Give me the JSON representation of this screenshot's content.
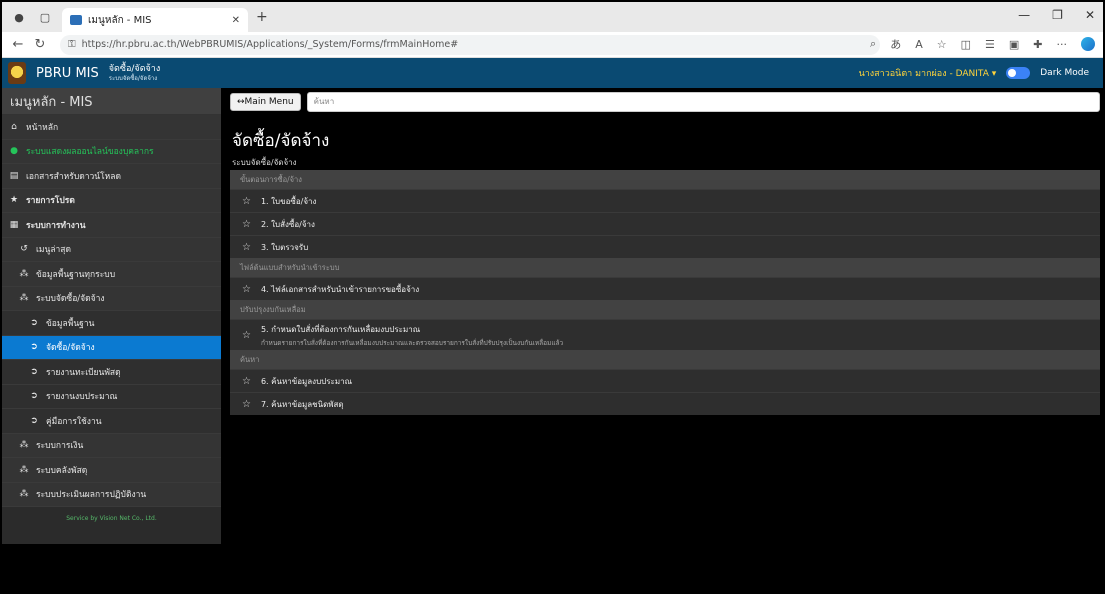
{
  "browser": {
    "tab_title": "เมนูหลัก - MIS",
    "url": "https://hr.pbru.ac.th/WebPBRUMIS/Applications/_System/Forms/frmMainHome#"
  },
  "header": {
    "brand": "PBRU MIS",
    "module_title": "จัดซื้อ/จัดจ้าง",
    "module_sub": "ระบบจัดซื้อ/จัดจ้าง",
    "user": "นางสาวอนิตา มากผ่อง - DANITA",
    "dark_mode_label": "Dark Mode"
  },
  "sidebar": {
    "title": "เมนูหลัก - MIS",
    "footer": "Service by Vision Net Co., Ltd.",
    "items": [
      {
        "label": "หน้าหลัก",
        "icon": "home-icon",
        "glyph": "⌂",
        "level": 0
      },
      {
        "label": "ระบบแสดงผลออนไลน์ของบุคลากร",
        "icon": "globe-icon",
        "glyph": "●",
        "level": 0,
        "style": "green"
      },
      {
        "label": "เอกสารสำหรับดาวน์โหลด",
        "icon": "document-icon",
        "glyph": "▤",
        "level": 0
      },
      {
        "label": "รายการโปรด",
        "icon": "star-icon",
        "glyph": "★",
        "level": 0,
        "style": "bold"
      },
      {
        "label": "ระบบการทำงาน",
        "icon": "grid-icon",
        "glyph": "▦",
        "level": 0,
        "style": "bold"
      },
      {
        "label": "เมนูล่าสุด",
        "icon": "history-icon",
        "glyph": "↺",
        "level": 1
      },
      {
        "label": "ข้อมูลพื้นฐานทุกระบบ",
        "icon": "cubes-icon",
        "glyph": "⁂",
        "level": 1
      },
      {
        "label": "ระบบจัดซื้อ/จัดจ้าง",
        "icon": "cubes-icon",
        "glyph": "⁂",
        "level": 1
      },
      {
        "label": "ข้อมูลพื้นฐาน",
        "icon": "circle-arrow-icon",
        "glyph": "➲",
        "level": 2
      },
      {
        "label": "จัดซื้อ/จัดจ้าง",
        "icon": "circle-arrow-icon",
        "glyph": "➲",
        "level": 2,
        "style": "active"
      },
      {
        "label": "รายงานทะเบียนพัสดุ",
        "icon": "circle-arrow-icon",
        "glyph": "➲",
        "level": 2
      },
      {
        "label": "รายงานงบประมาณ",
        "icon": "circle-arrow-icon",
        "glyph": "➲",
        "level": 2
      },
      {
        "label": "คู่มือการใช้งาน",
        "icon": "circle-arrow-icon",
        "glyph": "➲",
        "level": 2
      },
      {
        "label": "ระบบการเงิน",
        "icon": "cubes-icon",
        "glyph": "⁂",
        "level": 1
      },
      {
        "label": "ระบบคลังพัสดุ",
        "icon": "cubes-icon",
        "glyph": "⁂",
        "level": 1
      },
      {
        "label": "ระบบประเมินผลการปฏิบัติงาน",
        "icon": "cubes-icon",
        "glyph": "⁂",
        "level": 1
      }
    ]
  },
  "main": {
    "main_menu_button": "↔Main Menu",
    "search_placeholder": "ค้นหา",
    "page_title": "จัดซื้อ/จัดจ้าง",
    "page_subtitle": "ระบบจัดซื้อ/จัดจ้าง",
    "sections": [
      {
        "title": "ขั้นตอนการซื้อ/จ้าง",
        "rows": [
          {
            "label": "1. ใบขอซื้อ/จ้าง"
          },
          {
            "label": "2. ใบสั่งซื้อ/จ้าง"
          },
          {
            "label": "3. ใบตรวจรับ"
          }
        ]
      },
      {
        "title": "ไฟล์ต้นแบบสำหรับนำเข้าระบบ",
        "rows": [
          {
            "label": "4. ไฟล์เอกสารสำหรับนำเข้ารายการขอซื้อจ้าง"
          }
        ]
      },
      {
        "title": "ปรับปรุงงบกันเหลื่อม",
        "rows": [
          {
            "label": "5. กำหนดใบสั่งที่ต้องการกันเหลื่อมงบประมาณ",
            "desc": "กำหนดรายการใบสั่งที่ต้องการกันเหลื่อมงบประมาณและตรวจสอบรายการใบสั่งที่ปรับปรุงเป็นงบกันเหลื่อมแล้ว"
          }
        ]
      },
      {
        "title": "ค้นหา",
        "rows": [
          {
            "label": "6. ค้นหาข้อมูลงบประมาณ"
          },
          {
            "label": "7. ค้นหาข้อมูลชนิดพัสดุ"
          }
        ]
      }
    ]
  }
}
